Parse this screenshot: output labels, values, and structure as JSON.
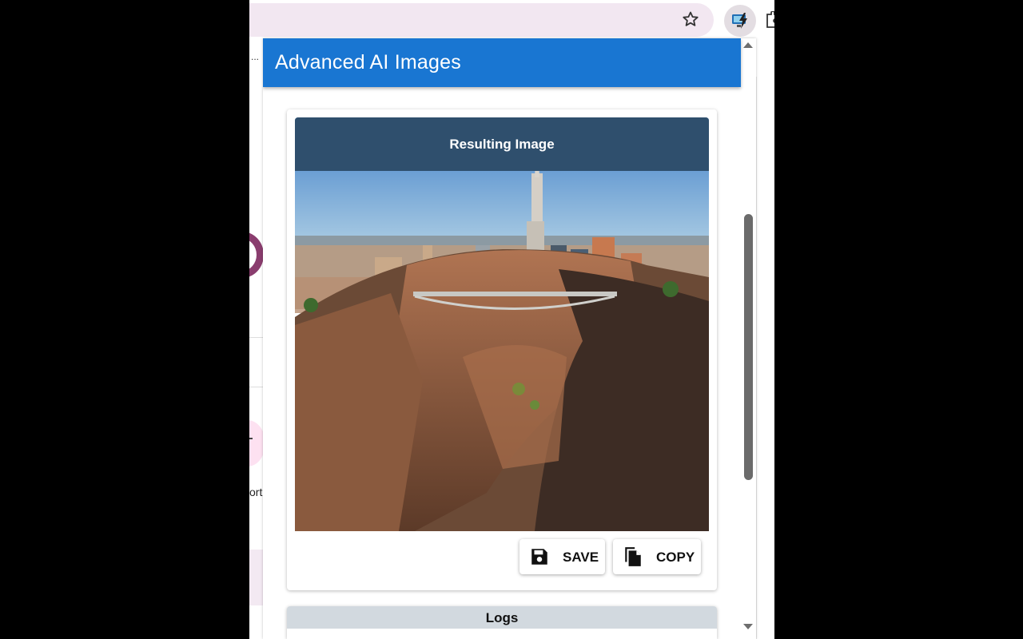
{
  "browser": {
    "bookmark_icon": "star-icon",
    "extension_icon": "extension-ai-icon",
    "extensions_menu_icon": "puzzle-icon"
  },
  "background_page": {
    "ellipsis": "...",
    "fragment_text": "ort"
  },
  "app": {
    "title": "Advanced AI Images",
    "accent": "#1976d2"
  },
  "result": {
    "header": "Resulting Image",
    "image_alt": "City skyline above a canyon with a bridge",
    "header_color": "#2f4f6d"
  },
  "actions": {
    "save_label": "SAVE",
    "save_icon": "floppy-disk-icon",
    "copy_label": "COPY",
    "copy_icon": "copy-file-icon"
  },
  "logs": {
    "title": "Logs"
  }
}
